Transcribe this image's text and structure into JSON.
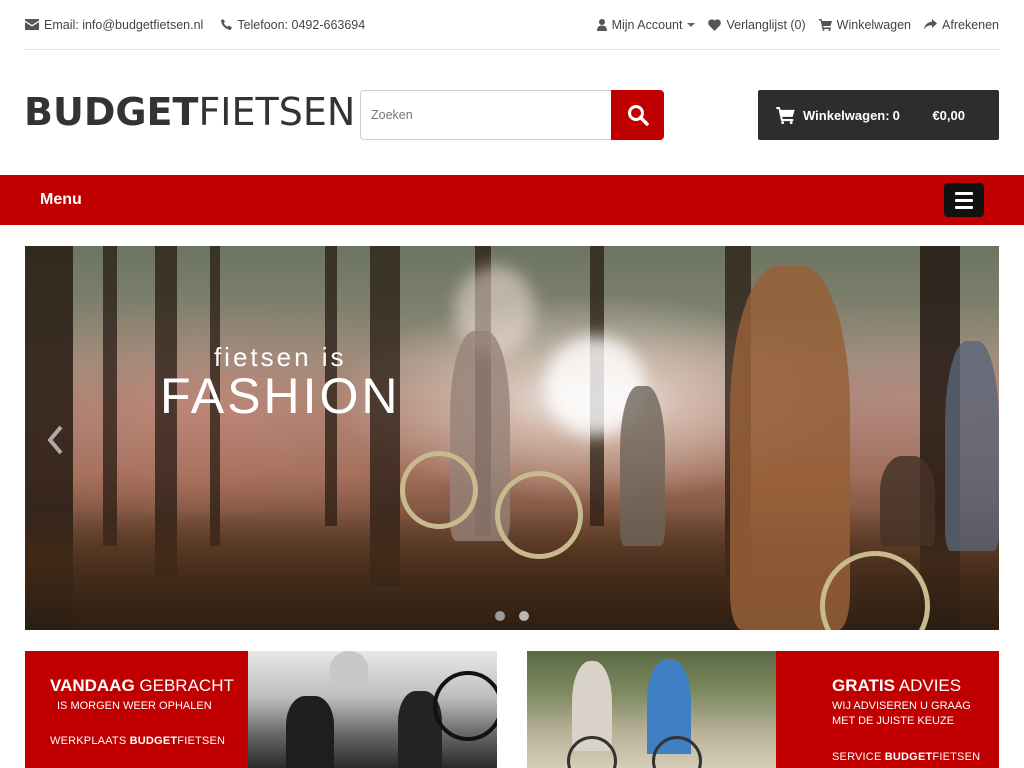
{
  "topbar": {
    "email": "Email: info@budgetfietsen.nl",
    "phone": "Telefoon: 0492-663694",
    "account": "Mijn Account",
    "wishlist": "Verlanglijst (0)",
    "cart": "Winkelwagen",
    "checkout": "Afrekenen"
  },
  "logo": {
    "bold": "BUDGET",
    "light": "FIETSEN"
  },
  "search": {
    "placeholder": "Zoeken"
  },
  "cart_box": {
    "label": "Winkelwagen:",
    "count": "0",
    "amount": "€0,00"
  },
  "menu": {
    "label": "Menu"
  },
  "slider": {
    "line1": "fietsen is",
    "line2": "FASHION",
    "active_dot": 0,
    "dot_count": 2
  },
  "banners": {
    "left": {
      "title_bold": "VANDAAG",
      "title_rest": " GEBRACHT",
      "subtitle": "IS MORGEN WEER OPHALEN",
      "footer_pre": "WERKPLAATS ",
      "footer_bold": "BUDGET",
      "footer_post": "FIETSEN"
    },
    "right": {
      "title_bold": "GRATIS",
      "title_rest": " ADVIES",
      "subtitle_1": "WIJ ADVISEREN U GRAAG",
      "subtitle_2": "MET DE JUISTE KEUZE",
      "footer_pre": "SERVICE ",
      "footer_bold": "BUDGET",
      "footer_post": "FIETSEN"
    }
  },
  "colors": {
    "brand_red": "#c00000",
    "dark": "#2d2d2d"
  }
}
